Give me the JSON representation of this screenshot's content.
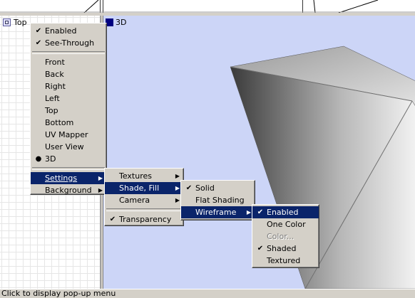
{
  "viewports": {
    "top_label": "Top",
    "view3d_label": "3D"
  },
  "status_text": "Click to display pop-up menu",
  "main_menu": {
    "items": [
      {
        "label": "Enabled",
        "mark": "✔"
      },
      {
        "label": "See-Through",
        "mark": "✔"
      },
      {
        "label": "Front",
        "mark": ""
      },
      {
        "label": "Back",
        "mark": ""
      },
      {
        "label": "Right",
        "mark": ""
      },
      {
        "label": "Left",
        "mark": ""
      },
      {
        "label": "Top",
        "mark": ""
      },
      {
        "label": "Bottom",
        "mark": ""
      },
      {
        "label": "UV Mapper",
        "mark": ""
      },
      {
        "label": "User View",
        "mark": ""
      },
      {
        "label": "3D",
        "mark": "●"
      },
      {
        "label": "Settings",
        "mark": "",
        "submenu": true,
        "highlighted": true
      },
      {
        "label": "Background",
        "mark": "",
        "submenu": true
      }
    ]
  },
  "settings_menu": {
    "items": [
      {
        "label": "Textures",
        "submenu": true
      },
      {
        "label": "Shade, Fill",
        "submenu": true,
        "highlighted": true
      },
      {
        "label": "Camera",
        "submenu": true
      },
      {
        "label": "Transparency",
        "mark": "✔"
      }
    ]
  },
  "shade_menu": {
    "items": [
      {
        "label": "Solid",
        "mark": "✔"
      },
      {
        "label": "Flat Shading",
        "mark": ""
      },
      {
        "label": "Wireframe",
        "submenu": true,
        "highlighted": true
      }
    ]
  },
  "wireframe_menu": {
    "items": [
      {
        "label": "Enabled",
        "mark": "✔",
        "highlighted": true
      },
      {
        "label": "One Color",
        "mark": ""
      },
      {
        "label": "Color...",
        "mark": "",
        "disabled": true
      },
      {
        "label": "Shaded",
        "mark": "✔"
      },
      {
        "label": "Textured",
        "mark": ""
      }
    ]
  },
  "colors": {
    "menu_bg": "#d4d0c8",
    "highlight": "#0a246a",
    "viewport_3d_bg": "#ccd5f7"
  }
}
